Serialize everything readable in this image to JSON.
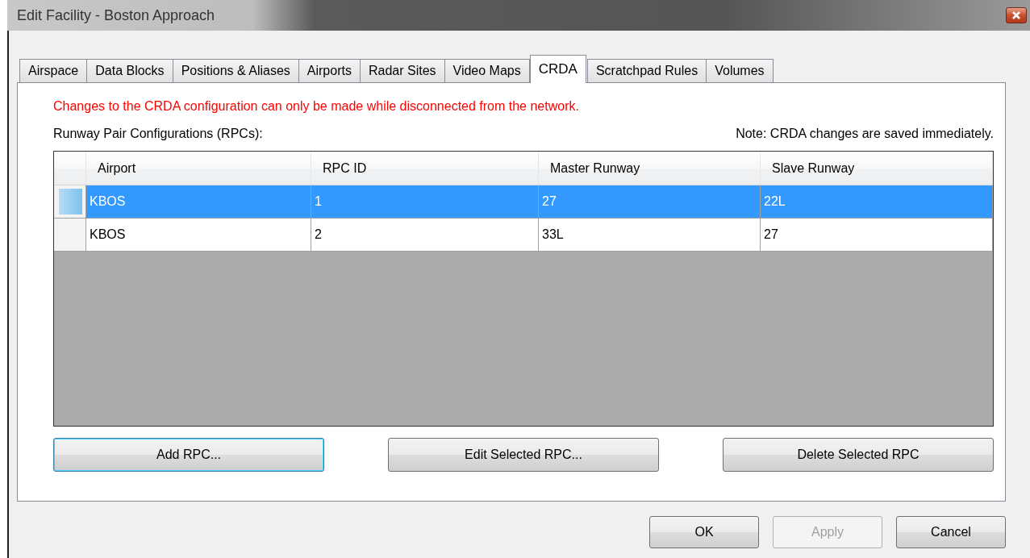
{
  "window": {
    "title": "Edit Facility - Boston Approach"
  },
  "tabs": [
    {
      "label": "Airspace",
      "selected": false
    },
    {
      "label": "Data Blocks",
      "selected": false
    },
    {
      "label": "Positions & Aliases",
      "selected": false
    },
    {
      "label": "Airports",
      "selected": false
    },
    {
      "label": "Radar Sites",
      "selected": false
    },
    {
      "label": "Video Maps",
      "selected": false
    },
    {
      "label": "CRDA",
      "selected": true
    },
    {
      "label": "Scratchpad Rules",
      "selected": false
    },
    {
      "label": "Volumes",
      "selected": false
    }
  ],
  "warning": "Changes to the CRDA configuration can only be made while disconnected from the network.",
  "list_label": "Runway Pair Configurations (RPCs):",
  "note": "Note: CRDA changes are saved immediately.",
  "table": {
    "columns": [
      "Airport",
      "RPC ID",
      "Master Runway",
      "Slave Runway"
    ],
    "rows": [
      {
        "cells": [
          "KBOS",
          "1",
          "27",
          "22L"
        ],
        "selected": true
      },
      {
        "cells": [
          "KBOS",
          "2",
          "33L",
          "27"
        ],
        "selected": false
      }
    ]
  },
  "actions": [
    {
      "label": "Add RPC...",
      "focused": true
    },
    {
      "label": "Edit Selected RPC...",
      "focused": false
    },
    {
      "label": "Delete Selected RPC",
      "focused": false
    }
  ],
  "buttons": [
    {
      "label": "OK",
      "disabled": false
    },
    {
      "label": "Apply",
      "disabled": true
    },
    {
      "label": "Cancel",
      "disabled": false
    }
  ]
}
